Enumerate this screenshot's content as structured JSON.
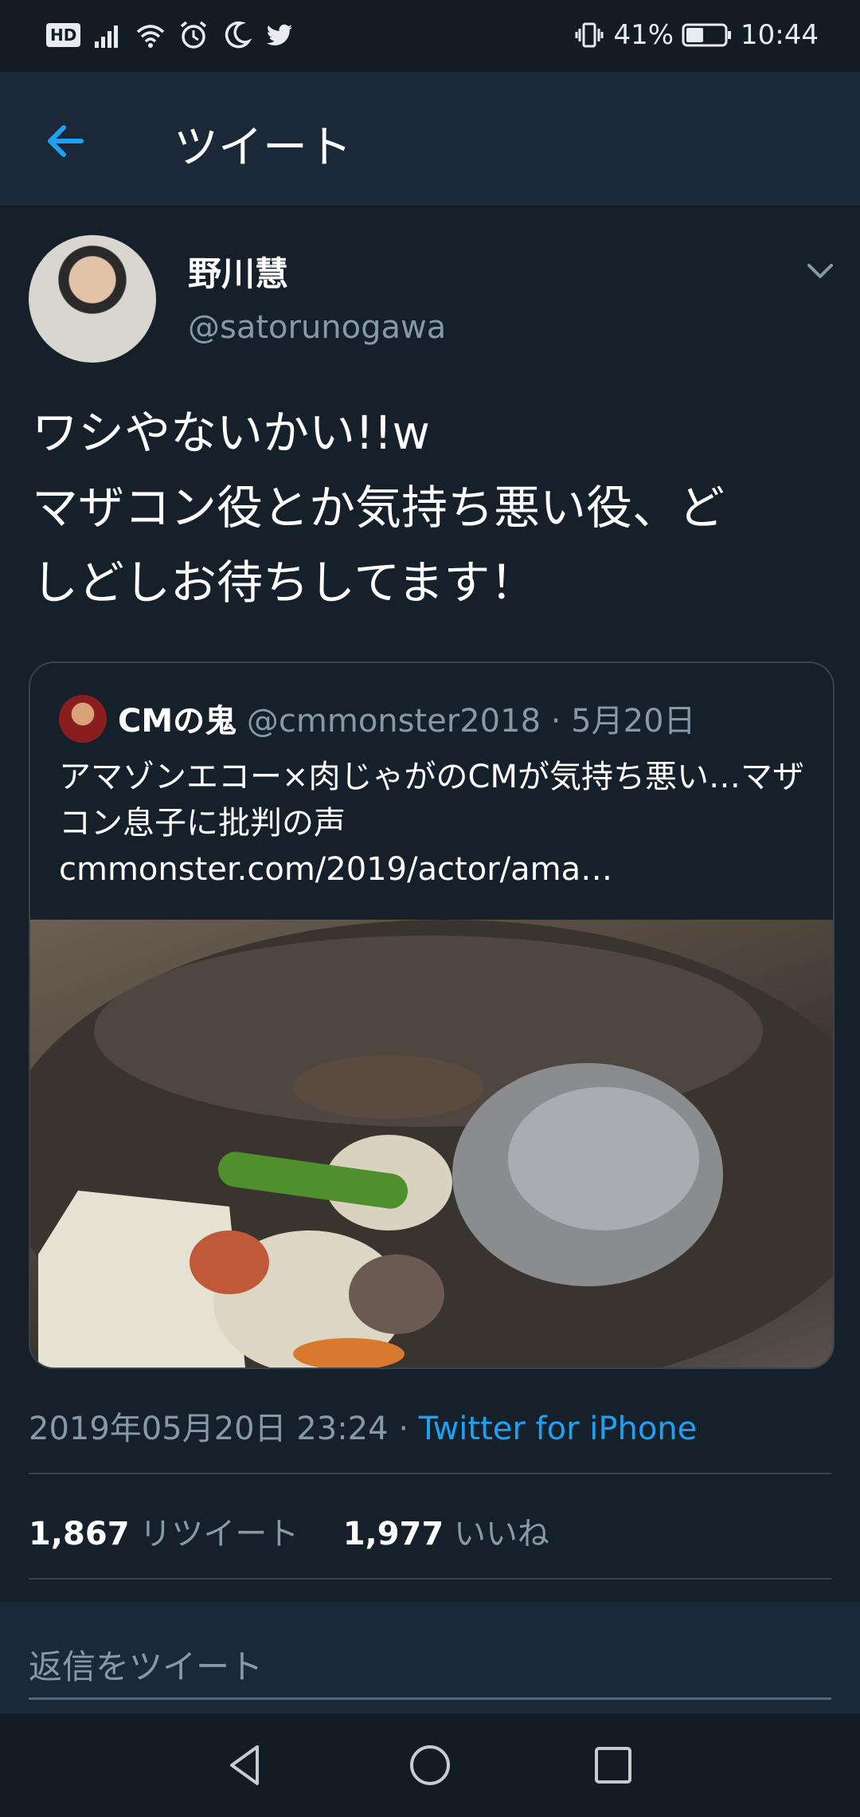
{
  "status_bar": {
    "badge": "HD",
    "battery": "41%",
    "time": "10:44"
  },
  "app_bar": {
    "title": "ツイート"
  },
  "tweet": {
    "display_name": "野川慧",
    "handle": "@satorunogawa",
    "text": "ワシやないかい!!w\nマザコン役とか気持ち悪い役、ど\nしどしお待ちしてます！",
    "quoted": {
      "name": "CMの鬼",
      "handle": "@cmmonster2018",
      "separator": "·",
      "date": "5月20日",
      "text": "アマゾンエコー×肉じゃがのCMが気持ち悪い…マザコン息子に批判の声 cmmonster.com/2019/actor/ama…"
    },
    "timestamp": "2019年05月20日 23:24",
    "source_separator": "·",
    "source": "Twitter for iPhone",
    "retweets_count": "1,867",
    "retweets_label": "リツイート",
    "likes_count": "1,977",
    "likes_label": "いいね"
  },
  "reply": {
    "placeholder": "返信をツイート"
  },
  "colors": {
    "background": "#15202b",
    "accent": "#1da1f2",
    "muted": "#8899a6",
    "border": "#38444d"
  },
  "icons": [
    "signal-icon",
    "wifi-icon",
    "alarm-icon",
    "moon-icon",
    "twitter-bird-icon",
    "vibrate-icon",
    "battery-icon",
    "back-arrow-icon",
    "chevron-down-icon",
    "nav-back-icon",
    "nav-home-icon",
    "nav-recents-icon"
  ]
}
